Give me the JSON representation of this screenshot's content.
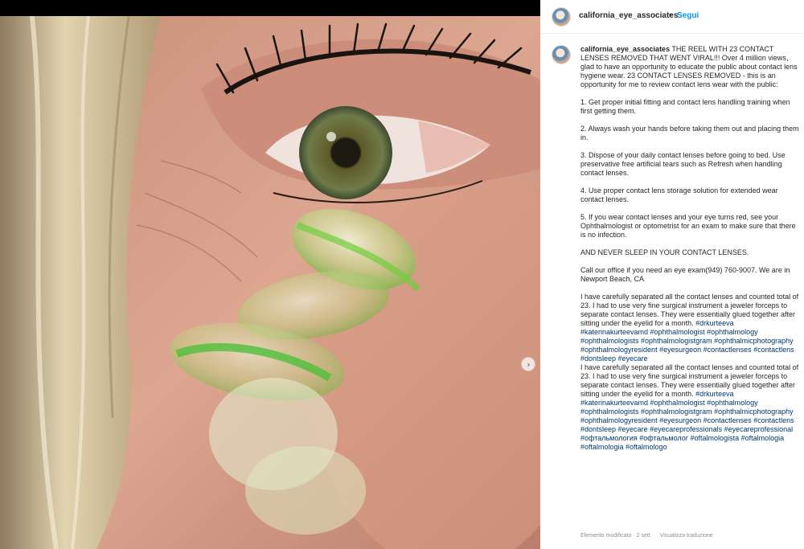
{
  "post": {
    "username": "california_eye_associates",
    "separator": "•",
    "follow_label": "Segui"
  },
  "caption": {
    "username": "california_eye_associates",
    "intro": "THE REEL WITH 23 CONTACT LENSES REMOVED THAT WENT VIRAL!!! Over 4 million views, glad to have an opportunity to educate the public about contact lens hygiene wear. 23 CONTACT LENSES REMOVED - this is an opportunity for me to review contact lens wear with the public:",
    "tips": [
      "1. Get proper initial fitting and contact lens handling training when first getting them.",
      "2. Always wash your hands before taking them out and placing them in.",
      "3. Dispose of your daily contact lenses before going to bed. Use preservative free artificial tears such as Refresh when handling contact lenses.",
      "4. Use proper contact lens storage solution for extended wear contact lenses.",
      "5. If you wear contact lenses and your eye turns red, see your Ophthalmologist or optometrist for an exam to make sure that there is no infection."
    ],
    "warning": "AND NEVER SLEEP IN YOUR CONTACT LENSES.",
    "call": "Call our office if you need an eye exam(949) 760-9007. We are in Newport Beach, CA",
    "story_1": "I have carefully separated all the contact lenses and counted total of 23. I had to use very fine surgical instrument a jeweler forceps to separate contact lenses. They were essentially glued together after sitting under the eyelid for a month.",
    "tags_1": "#drkurteeva #katerinakurteevamd #ophthalmologist #ophthalmology #ophthalmologists #ophthalmologistgram #ophthalmicphotography #ophthalmologyresident #eyesurgeon #contactlenses #contactlens #dontsleep #eyecare",
    "story_2": "I have carefully separated all the contact lenses and counted total of 23. I had to use very fine surgical instrument a jeweler forceps to separate contact lenses. They were essentially glued together after sitting under the eyelid for a month.",
    "tags_2": "#drkurteeva #katerinakurteevamd #ophthalmologist #ophthalmology #ophthalmologists #ophthalmologistgram #ophthalmicphotography #ophthalmologyresident #eyesurgeon #contactlenses #contactlens #dontsleep #eyecare #eyecareprofessionals #eyecareprofessional #офтальмология #офтальмолог #oftalmologista #oftalmologia #oftalmologia #oftalmologo"
  },
  "meta": {
    "edited": "Elemento modificato · 2 sett.",
    "translate": "Visualizza traduzione"
  },
  "icons": {
    "next": "chevron-right-icon"
  }
}
